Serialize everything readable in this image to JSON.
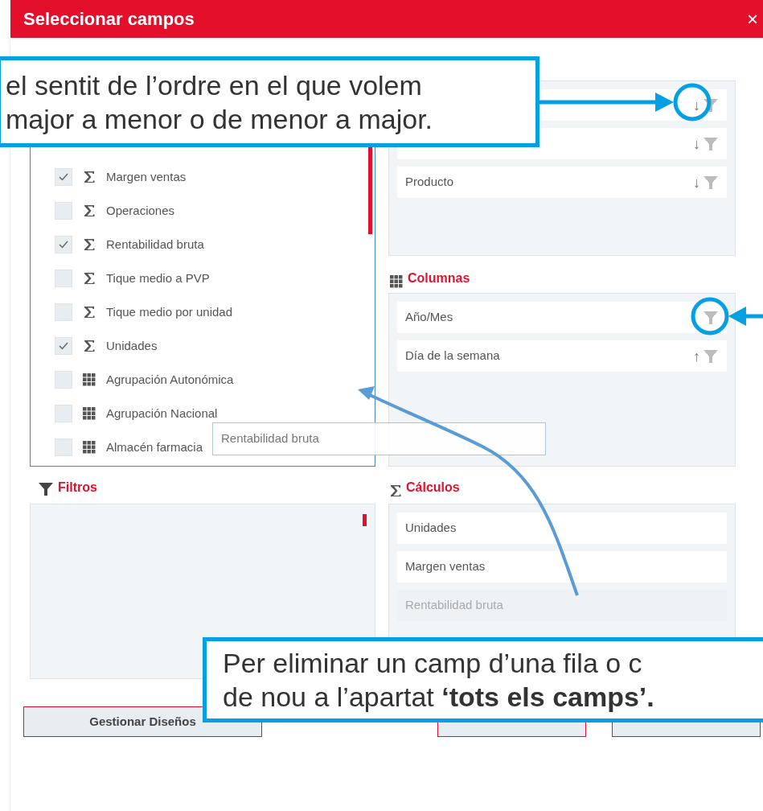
{
  "window": {
    "title": "Seleccionar campos",
    "close": "×"
  },
  "all_fields": [
    {
      "label": "Margen ventas",
      "kind": "measure",
      "checked": true
    },
    {
      "label": "Operaciones",
      "kind": "measure",
      "checked": false
    },
    {
      "label": "Rentabilidad bruta",
      "kind": "measure",
      "checked": true
    },
    {
      "label": "Tique medio a PVP",
      "kind": "measure",
      "checked": false
    },
    {
      "label": "Tique medio por unidad",
      "kind": "measure",
      "checked": false
    },
    {
      "label": "Unidades",
      "kind": "measure",
      "checked": true
    },
    {
      "label": "Agrupación Autonómica",
      "kind": "dimension",
      "checked": false
    },
    {
      "label": "Agrupación Nacional",
      "kind": "dimension",
      "checked": false
    },
    {
      "label": "Almacén farmacia",
      "kind": "dimension",
      "checked": false
    }
  ],
  "drag_ghost": {
    "label": "Rentabilidad bruta"
  },
  "filas": {
    "rows": [
      {
        "sort": "↓"
      },
      {
        "sort": "↓"
      },
      {
        "label": "Producto",
        "sort": "↓"
      }
    ]
  },
  "columnas": {
    "title": "Columnas",
    "rows": [
      {
        "label": "Año/Mes"
      },
      {
        "label": "Día de la semana",
        "sort": "↑"
      }
    ]
  },
  "filtros": {
    "title": "Filtros"
  },
  "calculos": {
    "title": "Cálculos",
    "rows": [
      {
        "label": "Unidades",
        "dragging": false
      },
      {
        "label": "Margen ventas",
        "dragging": false
      },
      {
        "label": "Rentabilidad bruta",
        "dragging": true
      }
    ]
  },
  "buttons": [
    {
      "label": "Gestionar Diseños",
      "kind": "manage"
    },
    {
      "kind": "apply"
    },
    {
      "kind": "cancel"
    }
  ],
  "callouts": [
    {
      "lines": [
        "el sentit de l’ordre en el que volem",
        "major a menor o de menor a major."
      ]
    },
    {
      "lines": [
        "Per eliminar un camp d’una fila o c",
        "de nou a l’apartat **‘tots els camps’.**"
      ]
    }
  ]
}
